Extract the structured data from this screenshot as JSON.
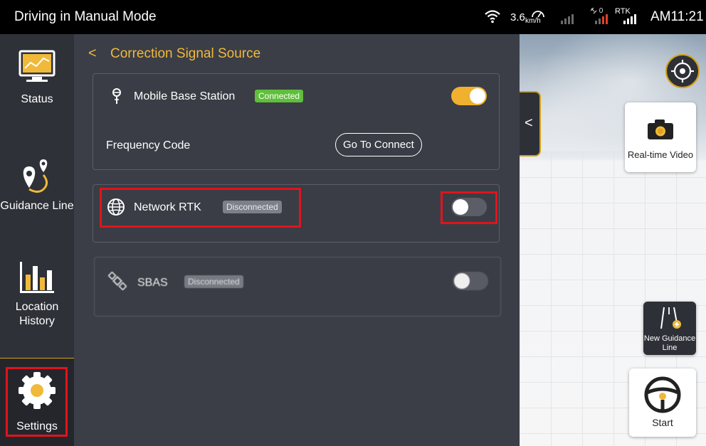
{
  "topbar": {
    "title": "Driving in Manual Mode",
    "speed": "3.6",
    "speed_unit": "km/h",
    "satellites": "0",
    "rtk_label": "RTK",
    "time": "AM11:21"
  },
  "sidebar": {
    "items": [
      {
        "label": "Status",
        "icon": "chart-monitor-icon"
      },
      {
        "label": "Guidance Line",
        "icon": "route-pin-icon"
      },
      {
        "label": "Location",
        "label2": "History",
        "icon": "bar-chart-icon"
      },
      {
        "label": "Settings",
        "icon": "gear-icon",
        "active": true
      }
    ]
  },
  "main": {
    "header": {
      "back_glyph": "<",
      "title": "Correction Signal Source"
    },
    "mobile_base": {
      "label": "Mobile Base Station",
      "status": "Connected",
      "enabled": true,
      "freq_label": "Frequency Code",
      "connect_label": "Go To Connect"
    },
    "network_rtk": {
      "label": "Network RTK",
      "status": "Disconnected",
      "enabled": false
    },
    "sbas": {
      "label": "SBAS",
      "status": "Disconnected",
      "enabled": false
    }
  },
  "mapview": {
    "collapse_glyph": "<",
    "video_label": "Real-time Video",
    "new_line_label": "New Guidance Line",
    "start_label": "Start"
  },
  "colors": {
    "accent": "#f0b93a",
    "connected": "#5fbf3b",
    "disconnected": "#7d8089",
    "highlight": "#e0141b"
  }
}
